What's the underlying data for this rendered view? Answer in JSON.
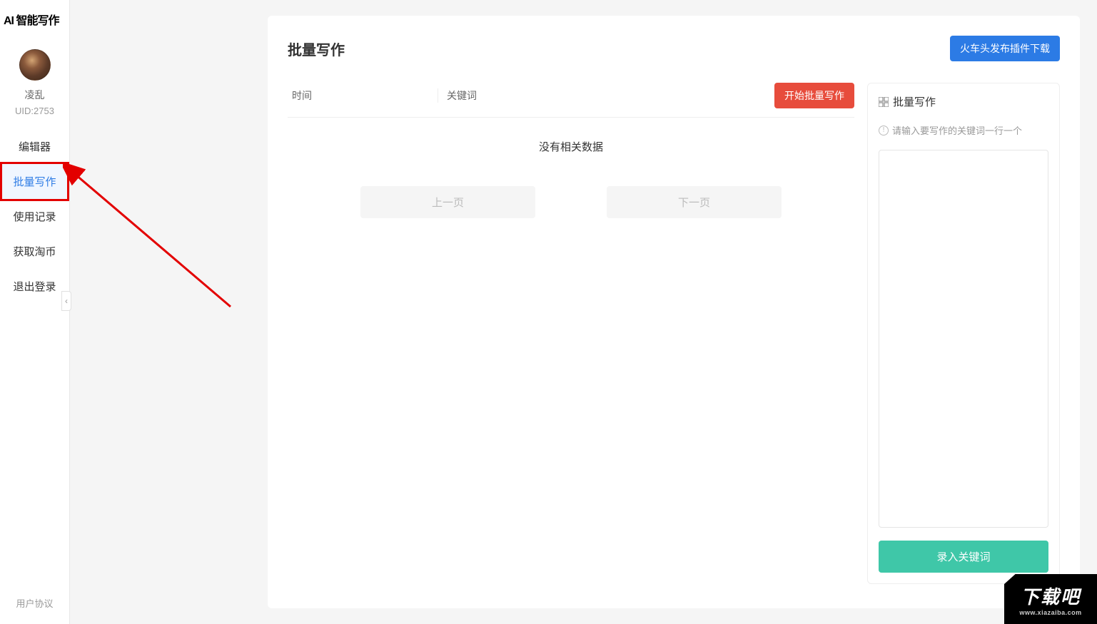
{
  "app": {
    "logo": "AI 智能写作"
  },
  "user": {
    "name": "凌乱",
    "uid": "UID:2753"
  },
  "sidebar": {
    "items": [
      {
        "label": "编辑器"
      },
      {
        "label": "批量写作"
      },
      {
        "label": "使用记录"
      },
      {
        "label": "获取淘币"
      },
      {
        "label": "退出登录"
      }
    ],
    "footer": "用户协议"
  },
  "page": {
    "title": "批量写作",
    "download_btn": "火车头发布插件下载"
  },
  "table": {
    "col_time": "时间",
    "col_keyword": "关键词",
    "start_btn": "开始批量写作",
    "no_data": "没有相关数据",
    "prev_page": "上一页",
    "next_page": "下一页"
  },
  "panel": {
    "title": "批量写作",
    "hint": "请输入要写作的关键词一行一个",
    "submit": "录入关键词"
  },
  "watermark": {
    "main": "下载吧",
    "sub": "www.xiazaiba.com"
  }
}
